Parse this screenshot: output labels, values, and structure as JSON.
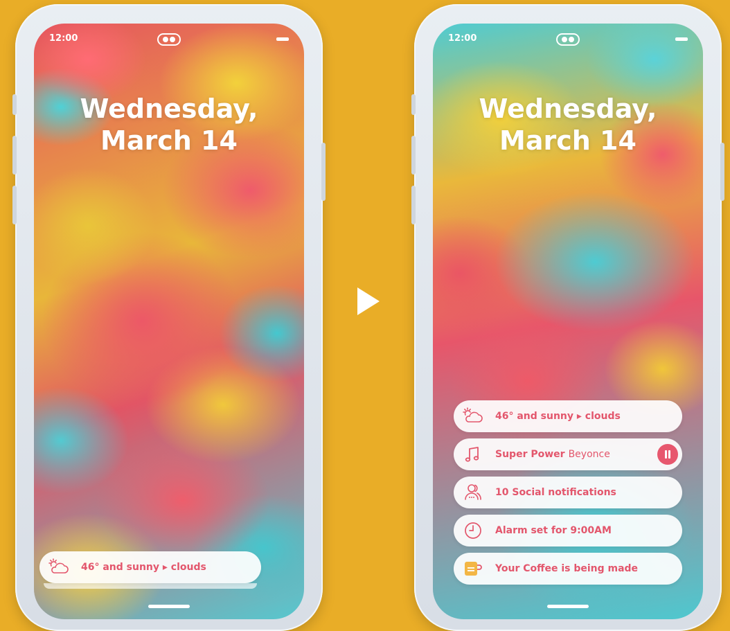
{
  "colors": {
    "background": "#e9ad27",
    "accent": "#e3566c",
    "card": "#ffffff"
  },
  "before": {
    "status": {
      "time": "12:00"
    },
    "date": {
      "line1": "Wednesday,",
      "line2": "March 14"
    },
    "weather_card": {
      "icon": "partly-cloudy-icon",
      "text": "46° and sunny ▸ clouds"
    }
  },
  "transition": {
    "icon": "play-arrow-icon"
  },
  "after": {
    "status": {
      "time": "12:00"
    },
    "date": {
      "line1": "Wednesday,",
      "line2": "March 14"
    },
    "cards": {
      "weather": {
        "icon": "partly-cloudy-icon",
        "text": "46° and sunny ▸ clouds"
      },
      "music": {
        "icon": "music-note-icon",
        "title": "Super Power",
        "artist": "Beyonce",
        "action_icon": "pause-icon"
      },
      "social": {
        "icon": "people-icon",
        "text": "10 Social notifications"
      },
      "alarm": {
        "icon": "clock-icon",
        "text": "Alarm set for 9:00AM"
      },
      "coffee": {
        "icon": "coffee-cup-icon",
        "text": "Your Coffee is being made"
      }
    }
  }
}
